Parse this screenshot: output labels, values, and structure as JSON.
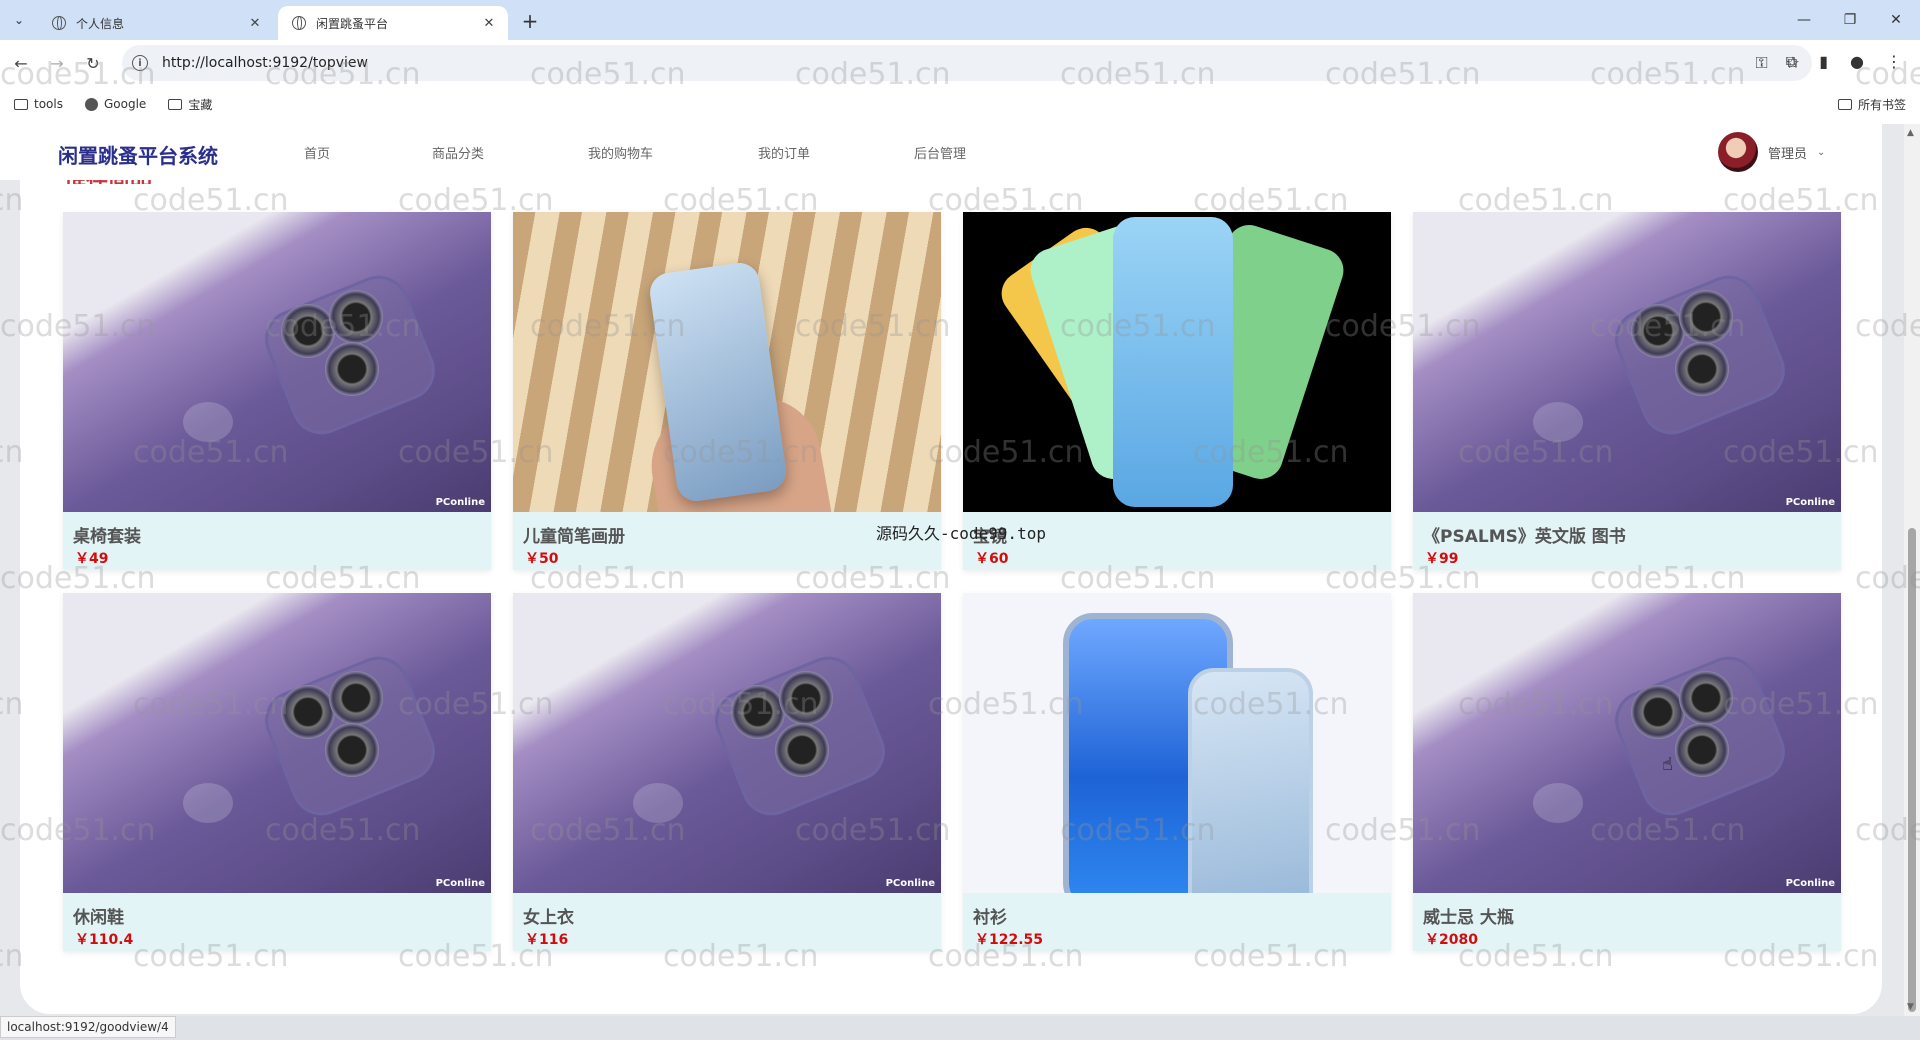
{
  "browser": {
    "tabs": [
      {
        "title": "个人信息",
        "active": false
      },
      {
        "title": "闲置跳蚤平台",
        "active": true
      }
    ],
    "url": "http://localhost:9192/topview",
    "bookmarks": [
      {
        "label": "tools",
        "icon": "folder-icon"
      },
      {
        "label": "Google",
        "icon": "google-icon"
      },
      {
        "label": "宝藏",
        "icon": "folder-icon"
      }
    ],
    "all_bookmarks": "所有书签",
    "status_url": "localhost:9192/goodview/4"
  },
  "site": {
    "brand": "闲置跳蚤平台系统",
    "nav": [
      "首页",
      "商品分类",
      "我的购物车",
      "我的订单",
      "后台管理"
    ],
    "user": "管理员",
    "section_title": "推荐商品"
  },
  "products": [
    {
      "name": "桌椅套装",
      "price": "￥49",
      "image": "purple-iphone"
    },
    {
      "name": "儿童简笔画册",
      "price": "￥50",
      "image": "hand-iphone"
    },
    {
      "name": "宝镜",
      "price": "￥60",
      "image": "colorful-iphones"
    },
    {
      "name": "《PSALMS》英文版 图书",
      "price": "￥99",
      "image": "purple-iphone"
    },
    {
      "name": "休闲鞋",
      "price": "￥110.4",
      "image": "purple-iphone"
    },
    {
      "name": "女上衣",
      "price": "￥116",
      "image": "purple-iphone"
    },
    {
      "name": "衬衫",
      "price": "￥122.55",
      "image": "blue-iphone"
    },
    {
      "name": "威士忌 大瓶",
      "price": "￥2080",
      "image": "purple-iphone"
    }
  ],
  "overlay_text": "源码久久-code99.top",
  "watermark": "code51.cn",
  "image_watermark": "PConline",
  "colors": {
    "brand": "#2b2f8c",
    "price": "#d10d0d",
    "card_bg": "#e3f4f7"
  }
}
